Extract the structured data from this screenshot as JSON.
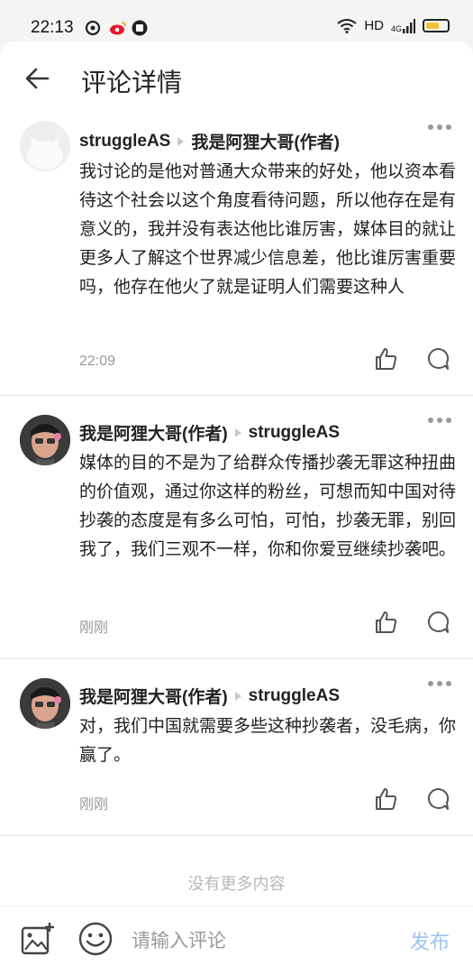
{
  "status_bar": {
    "time": "22:13",
    "network": "HD",
    "signal": "4G"
  },
  "header": {
    "title": "评论详情"
  },
  "comments": [
    {
      "author": "struggleAS",
      "reply_to": "我是阿狸大哥(作者)",
      "text": "我讨论的是他对普通大众带来的好处，他以资本看待这个社会以这个角度看待问题，所以他存在是有意义的，我并没有表达他比谁厉害，媒体目的就让更多人了解这个世界减少信息差，他比谁厉害重要吗，他存在他火了就是证明人们需要这种人",
      "time": "22:09"
    },
    {
      "author": "我是阿狸大哥(作者)",
      "reply_to": "struggleAS",
      "text": "媒体的目的不是为了给群众传播抄袭无罪这种扭曲的价值观，通过你这样的粉丝，可想而知中国对待抄袭的态度是有多么可怕，可怕，抄袭无罪，别回我了，我们三观不一样，你和你爱豆继续抄袭吧。",
      "time": "刚刚"
    },
    {
      "author": "我是阿狸大哥(作者)",
      "reply_to": "struggleAS",
      "text": "对，我们中国就需要多些这种抄袭者，没毛病，你赢了。",
      "time": "刚刚"
    }
  ],
  "footer": {
    "no_more": "没有更多内容"
  },
  "bottom_bar": {
    "placeholder": "请输入评论",
    "publish_label": "发布"
  },
  "colors": {
    "accent_disabled": "#9ec2ef",
    "muted": "#999999",
    "divider": "#e8e8e8"
  }
}
